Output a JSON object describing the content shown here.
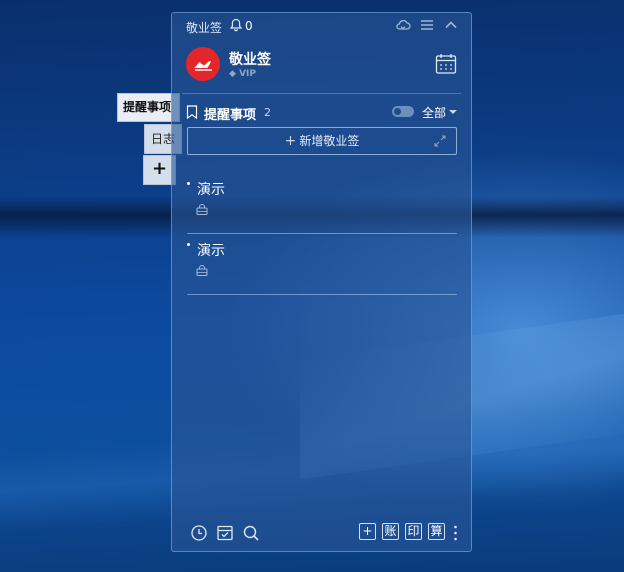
{
  "side_tabs": {
    "reminder": "提醒事项",
    "log": "日志",
    "add": "+"
  },
  "panel": {
    "app_title": "敬业签",
    "notification_count": "0",
    "profile": {
      "name": "敬业签",
      "badge": "VIP"
    },
    "section": {
      "title": "提醒事项",
      "count": "2",
      "filter": "全部"
    },
    "new_button": {
      "plus": "+",
      "label": "新增敬业签"
    },
    "notes": [
      {
        "text": "演示"
      },
      {
        "text": "演示"
      }
    ],
    "bottom_buttons": {
      "add": "+",
      "account": "账",
      "print": "印",
      "calc": "算"
    }
  },
  "colors": {
    "avatar": "#e3262b",
    "panel": "#28559a"
  },
  "icons": [
    "bell-icon",
    "cloud-icon",
    "menu-icon",
    "collapse-icon",
    "calendar-icon",
    "bookmark-icon",
    "expand-icon",
    "lock-icon",
    "clock-icon",
    "archive-icon",
    "search-icon",
    "more-icon"
  ]
}
